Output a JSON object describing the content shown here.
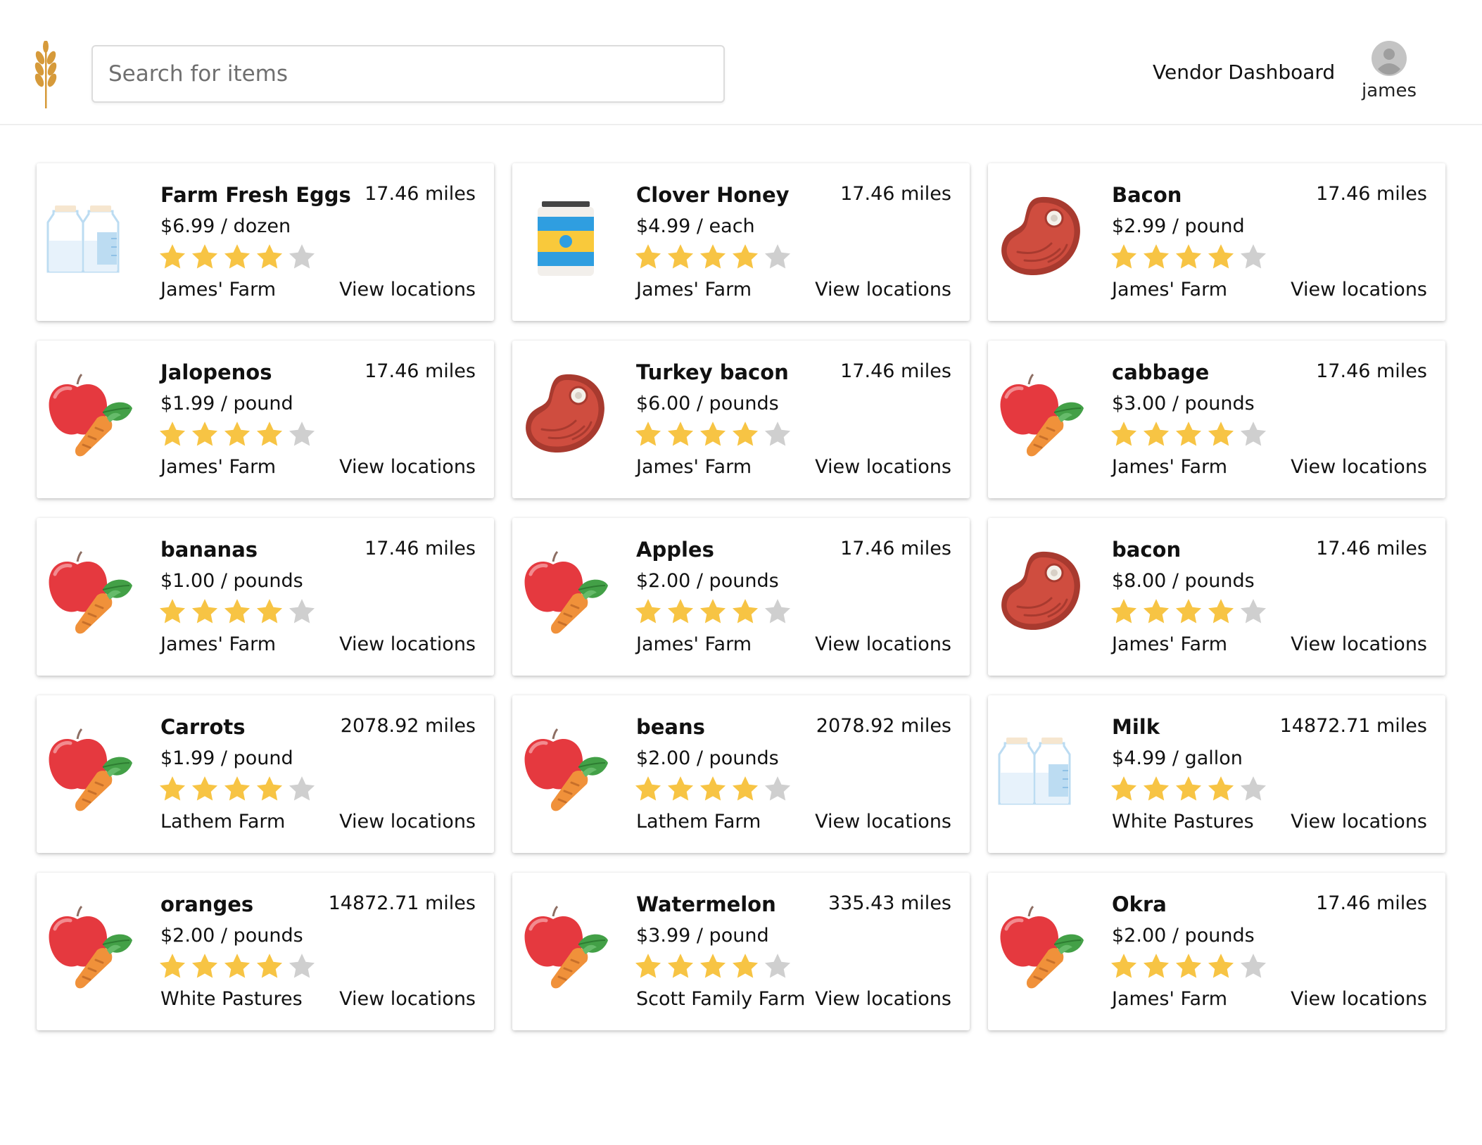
{
  "header": {
    "logo_icon": "wheat-icon",
    "search_placeholder": "Search for items",
    "vendor_dashboard": "Vendor Dashboard",
    "username": "james",
    "avatar_icon": "user-avatar-icon"
  },
  "colors": {
    "star_filled": "#f7c444",
    "star_empty": "#cfcfcf",
    "logo": "#d69a3a",
    "meat": "#c74a3c",
    "produce_red": "#e5393f",
    "produce_green": "#4caf50",
    "produce_orange": "#f0913a",
    "honey_blue": "#2f9ee0",
    "honey_yellow": "#f9c93b",
    "milk_blue": "#bcdcf2"
  },
  "items": [
    {
      "name": "Farm Fresh Eggs",
      "price": "$6.99 / dozen",
      "distance": "17.46 miles",
      "rating": 4,
      "farm": "James' Farm",
      "action": "View locations",
      "icon": "milk-icon"
    },
    {
      "name": "Clover Honey",
      "price": "$4.99 / each",
      "distance": "17.46 miles",
      "rating": 4,
      "farm": "James' Farm",
      "action": "View locations",
      "icon": "honey-jar-icon"
    },
    {
      "name": "Bacon",
      "price": "$2.99 / pound",
      "distance": "17.46 miles",
      "rating": 4,
      "farm": "James' Farm",
      "action": "View locations",
      "icon": "meat-icon"
    },
    {
      "name": "Jalopenos",
      "price": "$1.99 / pound",
      "distance": "17.46 miles",
      "rating": 4,
      "farm": "James' Farm",
      "action": "View locations",
      "icon": "produce-icon"
    },
    {
      "name": "Turkey bacon",
      "price": "$6.00 / pounds",
      "distance": "17.46 miles",
      "rating": 4,
      "farm": "James' Farm",
      "action": "View locations",
      "icon": "meat-icon"
    },
    {
      "name": "cabbage",
      "price": "$3.00 / pounds",
      "distance": "17.46 miles",
      "rating": 4,
      "farm": "James' Farm",
      "action": "View locations",
      "icon": "produce-icon"
    },
    {
      "name": "bananas",
      "price": "$1.00 / pounds",
      "distance": "17.46 miles",
      "rating": 4,
      "farm": "James' Farm",
      "action": "View locations",
      "icon": "produce-icon"
    },
    {
      "name": "Apples",
      "price": "$2.00 / pounds",
      "distance": "17.46 miles",
      "rating": 4,
      "farm": "James' Farm",
      "action": "View locations",
      "icon": "produce-icon"
    },
    {
      "name": "bacon",
      "price": "$8.00 / pounds",
      "distance": "17.46 miles",
      "rating": 4,
      "farm": "James' Farm",
      "action": "View locations",
      "icon": "meat-icon"
    },
    {
      "name": "Carrots",
      "price": "$1.99 / pound",
      "distance": "2078.92 miles",
      "rating": 4,
      "farm": "Lathem Farm",
      "action": "View locations",
      "icon": "produce-icon"
    },
    {
      "name": "beans",
      "price": "$2.00 / pounds",
      "distance": "2078.92 miles",
      "rating": 4,
      "farm": "Lathem Farm",
      "action": "View locations",
      "icon": "produce-icon"
    },
    {
      "name": "Milk",
      "price": "$4.99 / gallon",
      "distance": "14872.71 miles",
      "rating": 4,
      "farm": "White Pastures",
      "action": "View locations",
      "icon": "milk-icon"
    },
    {
      "name": "oranges",
      "price": "$2.00 / pounds",
      "distance": "14872.71 miles",
      "rating": 4,
      "farm": "White Pastures",
      "action": "View locations",
      "icon": "produce-icon"
    },
    {
      "name": "Watermelon",
      "price": "$3.99 / pound",
      "distance": "335.43 miles",
      "rating": 4,
      "farm": "Scott Family Farm",
      "action": "View locations",
      "icon": "produce-icon"
    },
    {
      "name": "Okra",
      "price": "$2.00 / pounds",
      "distance": "17.46 miles",
      "rating": 4,
      "farm": "James' Farm",
      "action": "View locations",
      "icon": "produce-icon"
    }
  ]
}
